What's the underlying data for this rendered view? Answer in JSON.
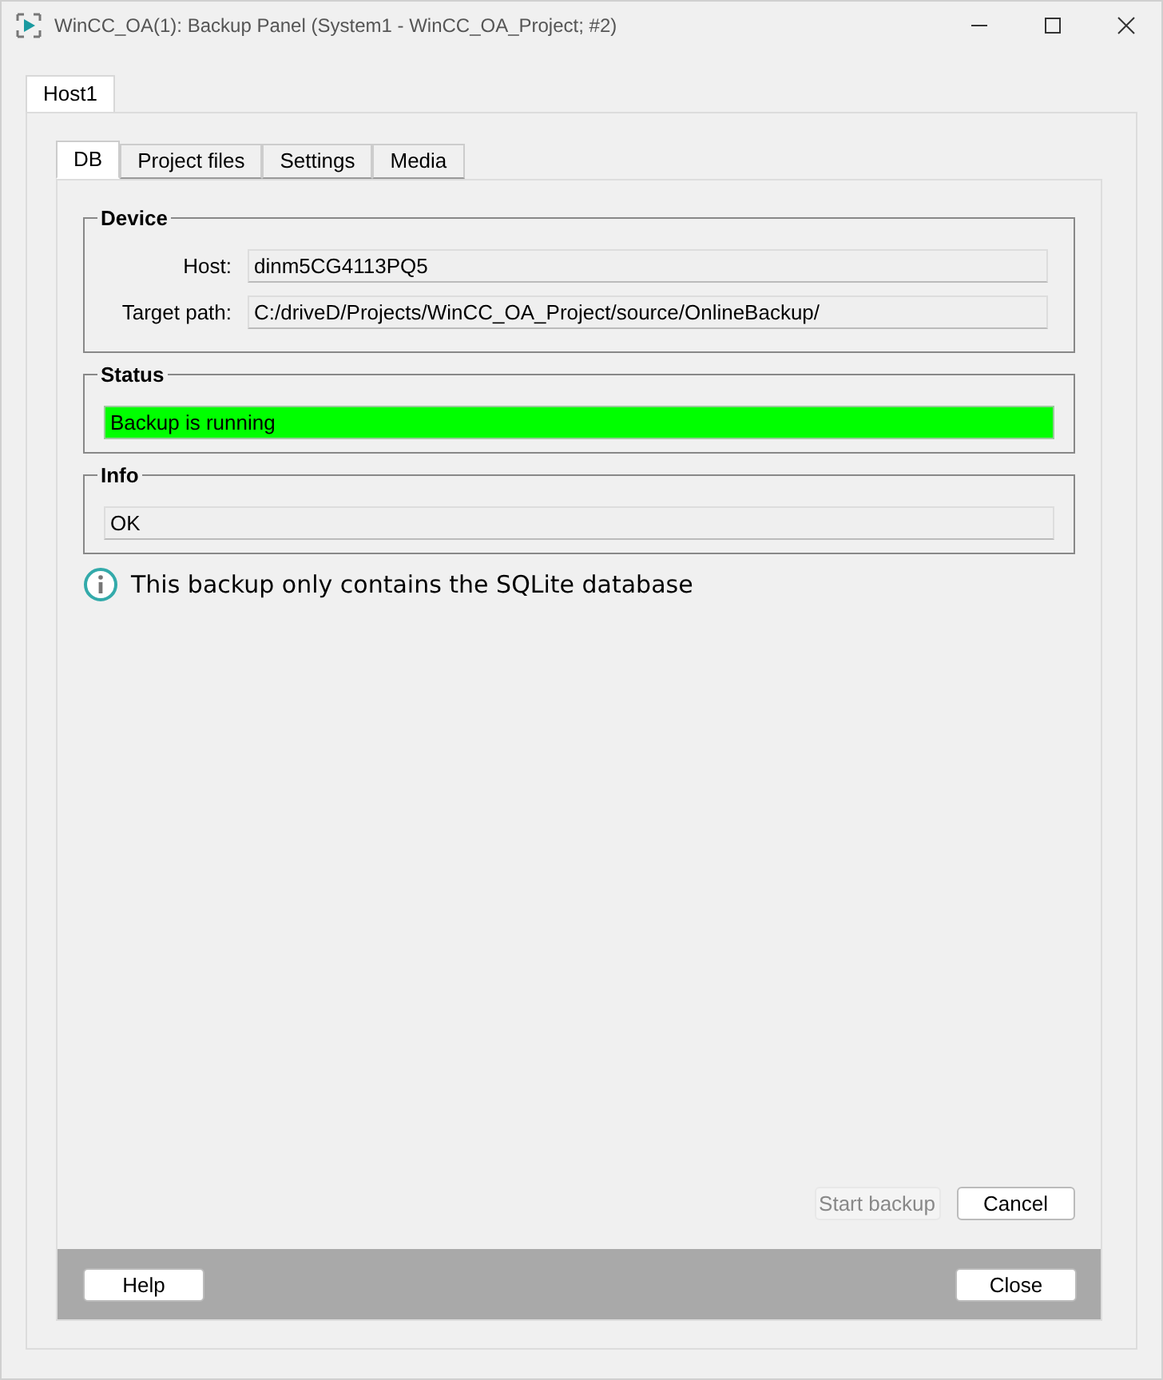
{
  "window": {
    "title": "WinCC_OA(1): Backup Panel (System1 - WinCC_OA_Project; #2)"
  },
  "host_tabs": [
    {
      "label": "Host1",
      "selected": true
    }
  ],
  "tabs": [
    {
      "label": "DB",
      "selected": true
    },
    {
      "label": "Project files",
      "selected": false
    },
    {
      "label": "Settings",
      "selected": false
    },
    {
      "label": "Media",
      "selected": false
    }
  ],
  "device": {
    "title": "Device",
    "fields": [
      {
        "label": "Host:",
        "value": "dinm5CG4113PQ5"
      },
      {
        "label": "Target path:",
        "value": "C:/driveD/Projects/WinCC_OA_Project/source/OnlineBackup/"
      }
    ]
  },
  "status": {
    "title": "Status",
    "value": "Backup is running",
    "color": "#00ff00"
  },
  "info": {
    "title": "Info",
    "value": "OK"
  },
  "note": "This backup only contains the SQLite database",
  "actions": [
    {
      "label": "Start backup",
      "disabled": true
    },
    {
      "label": "Cancel",
      "disabled": false
    }
  ],
  "footer_buttons": [
    "Help",
    "Close"
  ]
}
